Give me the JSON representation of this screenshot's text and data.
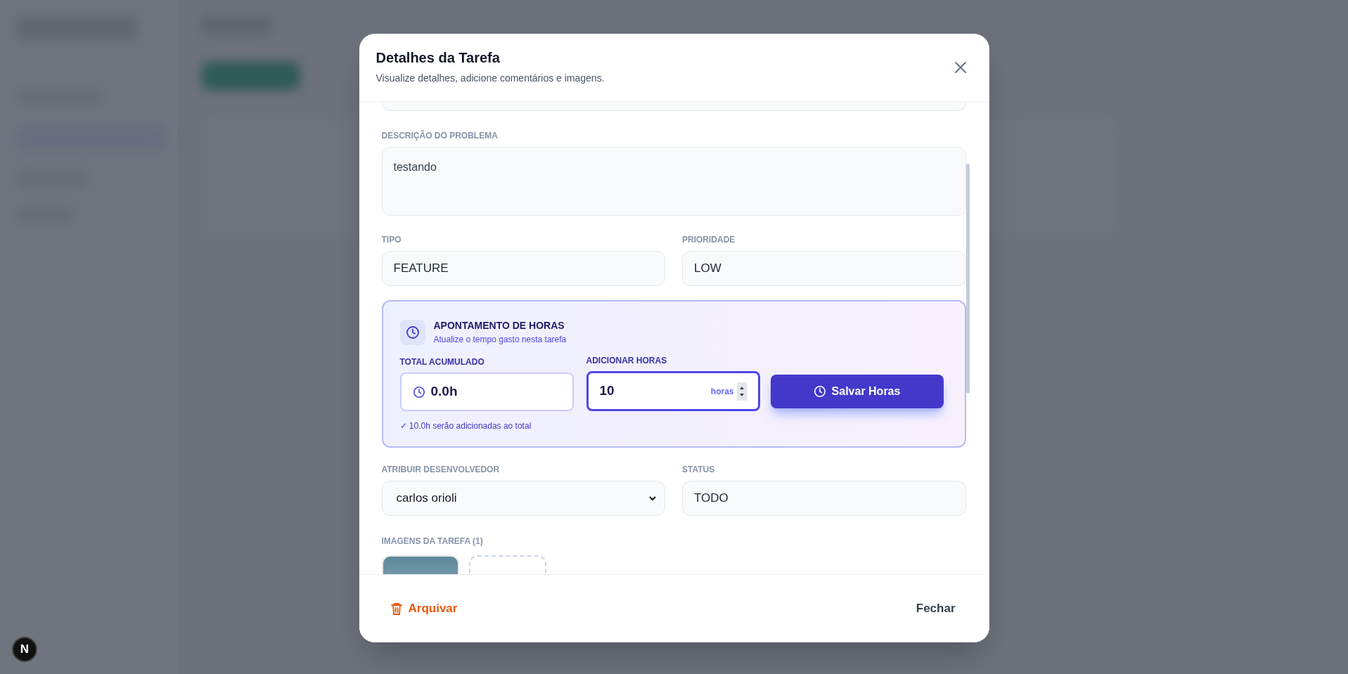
{
  "dialog": {
    "title": "Detalhes da Tarefa",
    "subtitle": "Visualize detalhes, adicione comentários e imagens."
  },
  "description": {
    "label": "DESCRIÇÃO DO PROBLEMA",
    "value": "testando"
  },
  "fields_row_1": [
    {
      "label": "TIPO",
      "value": "FEATURE"
    },
    {
      "label": "PRIORIDADE",
      "value": "LOW"
    }
  ],
  "hours": {
    "title": "APONTAMENTO DE HORAS",
    "subtitle": "Atualize o tempo gasto nesta tarefa",
    "total_label": "TOTAL ACUMULADO",
    "total_value": "0.0h",
    "add_label": "ADICIONAR HORAS",
    "add_value": "10",
    "add_suffix": "horas",
    "button": "Salvar Horas",
    "hint": "✓ 10.0h serão adicionadas ao total"
  },
  "developer": {
    "label": "ATRIBUIR DESENVOLVEDOR",
    "value": "carlos orioli"
  },
  "status": {
    "label": "STATUS",
    "value": "TODO"
  },
  "images": {
    "label": "IMAGENS DA TAREFA (1)"
  },
  "footer": {
    "archive": "Arquivar",
    "close": "Fechar"
  },
  "dev_indicator": "N"
}
